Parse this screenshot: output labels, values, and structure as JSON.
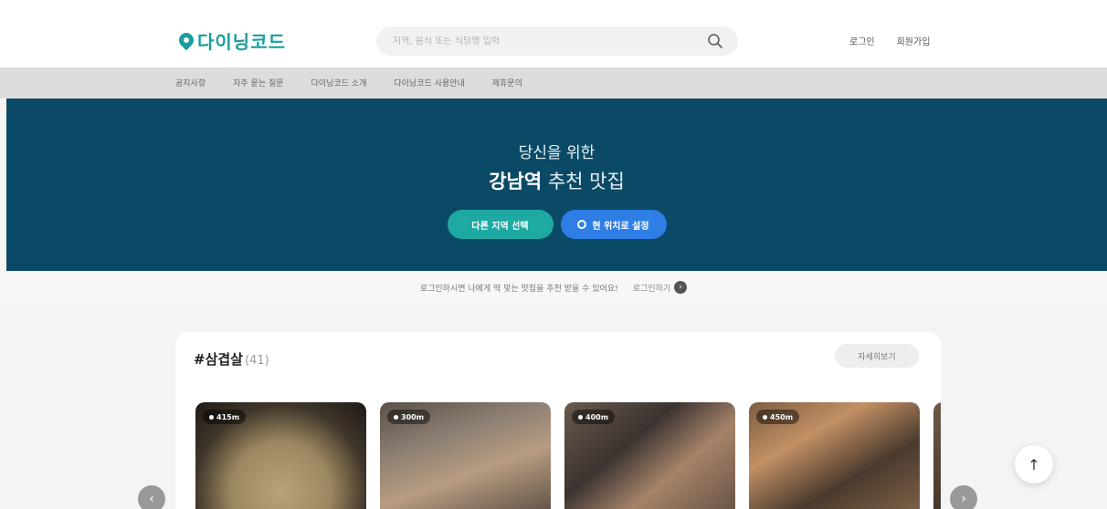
{
  "header": {
    "logo_text": "다이닝코드",
    "search_placeholder": "지역, 음식 또는 식당명 입력",
    "login_label": "로그인",
    "signup_label": "회원가입"
  },
  "nav": {
    "items": [
      {
        "label": "공지사항"
      },
      {
        "label": "자주 묻는 질문"
      },
      {
        "label": "다이닝코드 소개"
      },
      {
        "label": "다이닝코드 사용안내"
      },
      {
        "label": "제휴문의"
      }
    ]
  },
  "hero": {
    "line1": "당신을 위한",
    "location_bold": "강남역",
    "line2_rest": " 추천 맛집",
    "region_button": "다른 지역 선택",
    "location_button": "현 위치로 설정"
  },
  "info": {
    "message": "로그인하시면 나에게 딱 맞는 맛집을 추천 받을 수 있어요!",
    "login_link": "로그인하기"
  },
  "section": {
    "title": "#삼겹살",
    "count": "(41)",
    "more_label": "자세히보기"
  },
  "cards": [
    {
      "distance": "415m"
    },
    {
      "distance": "300m"
    },
    {
      "distance": "400m"
    },
    {
      "distance": "450m"
    }
  ],
  "colors": {
    "brand": "#1a9e9e",
    "hero_bg": "#0b4a66",
    "region_btn": "#1fa9a3",
    "location_btn": "#2f7ee6"
  },
  "icons": {
    "search": "search-icon",
    "scroll_top": "arrow-up-icon",
    "prev": "chevron-left-icon",
    "next": "chevron-right-icon"
  }
}
